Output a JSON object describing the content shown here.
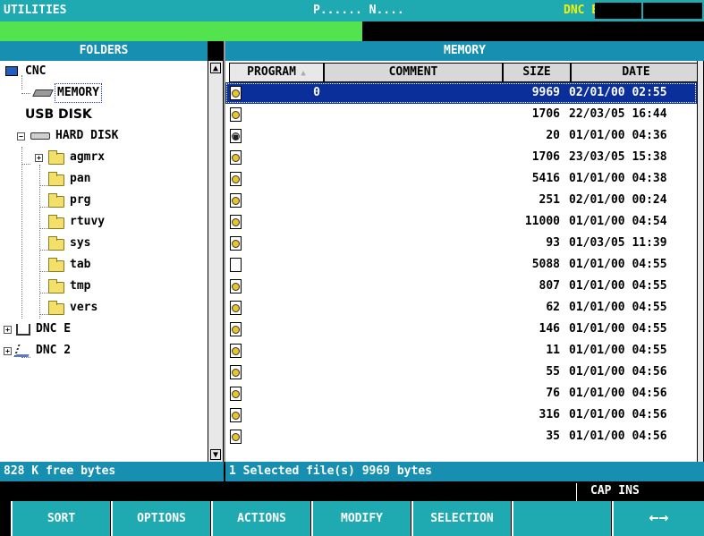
{
  "title_bar": {
    "app": "UTILITIES",
    "program": "P...... N....",
    "dnc": "DNC E"
  },
  "folders": {
    "header": "FOLDERS",
    "tree": [
      {
        "label": "CNC",
        "icon": "cnc-icon"
      },
      {
        "label": "MEMORY",
        "icon": "memory-chip-icon",
        "selected": true
      },
      {
        "label": "USB DISK",
        "icon": ""
      },
      {
        "label": "HARD DISK",
        "icon": "hard-disk-icon"
      },
      {
        "label": "agmrx",
        "icon": "folder-icon"
      },
      {
        "label": "pan",
        "icon": "folder-icon"
      },
      {
        "label": "prg",
        "icon": "folder-icon"
      },
      {
        "label": "rtuvy",
        "icon": "folder-icon"
      },
      {
        "label": "sys",
        "icon": "folder-icon"
      },
      {
        "label": "tab",
        "icon": "folder-icon"
      },
      {
        "label": "tmp",
        "icon": "folder-icon"
      },
      {
        "label": "vers",
        "icon": "folder-icon"
      },
      {
        "label": "DNC E",
        "icon": "network-icon"
      },
      {
        "label": "DNC 2",
        "icon": "serial-cable-icon"
      }
    ]
  },
  "memory": {
    "header": "MEMORY",
    "columns": {
      "program": "PROGRAM",
      "comment": "COMMENT",
      "size": "SIZE",
      "date": "DATE"
    },
    "rows": [
      {
        "program": "0",
        "size": "9969",
        "date": "02/01/00 02:55",
        "icon": "program-file-icon"
      },
      {
        "program": "",
        "size": "1706",
        "date": "22/03/05 16:44",
        "icon": "program-file-icon"
      },
      {
        "program": "",
        "size": "20",
        "date": "01/01/00 04:36",
        "icon": "locked-program-file-icon"
      },
      {
        "program": "",
        "size": "1706",
        "date": "23/03/05 15:38",
        "icon": "program-file-icon"
      },
      {
        "program": "",
        "size": "5416",
        "date": "01/01/00 04:38",
        "icon": "program-file-icon"
      },
      {
        "program": "",
        "size": "251",
        "date": "02/01/00 00:24",
        "icon": "program-file-icon"
      },
      {
        "program": "",
        "size": "11000",
        "date": "01/01/00 04:54",
        "icon": "program-file-icon"
      },
      {
        "program": "",
        "size": "93",
        "date": "01/03/05 11:39",
        "icon": "program-file-icon"
      },
      {
        "program": "",
        "size": "5088",
        "date": "01/01/00 04:55",
        "icon": "blank-file-icon"
      },
      {
        "program": "",
        "size": "807",
        "date": "01/01/00 04:55",
        "icon": "program-file-icon"
      },
      {
        "program": "",
        "size": "62",
        "date": "01/01/00 04:55",
        "icon": "program-file-icon"
      },
      {
        "program": "",
        "size": "146",
        "date": "01/01/00 04:55",
        "icon": "program-file-icon"
      },
      {
        "program": "",
        "size": "11",
        "date": "01/01/00 04:55",
        "icon": "program-file-icon"
      },
      {
        "program": "",
        "size": "55",
        "date": "01/01/00 04:56",
        "icon": "program-file-icon"
      },
      {
        "program": "",
        "size": "76",
        "date": "01/01/00 04:56",
        "icon": "program-file-icon"
      },
      {
        "program": "",
        "size": "316",
        "date": "01/01/00 04:56",
        "icon": "program-file-icon"
      },
      {
        "program": "",
        "size": "35",
        "date": "01/01/00 04:56",
        "icon": "program-file-icon"
      }
    ]
  },
  "status": {
    "free": "828 K free bytes",
    "selected": "1 Selected file(s) 9969  bytes",
    "caps": "CAP INS"
  },
  "softkeys": [
    "SORT",
    "OPTIONS",
    "ACTIONS",
    "MODIFY",
    "SELECTION",
    "",
    "←→"
  ],
  "colors": {
    "title": "#1fa9b0",
    "header": "#168fb0",
    "selection": "#0a2e9a",
    "message": "#53e34f",
    "dnc": "#f5f000"
  }
}
